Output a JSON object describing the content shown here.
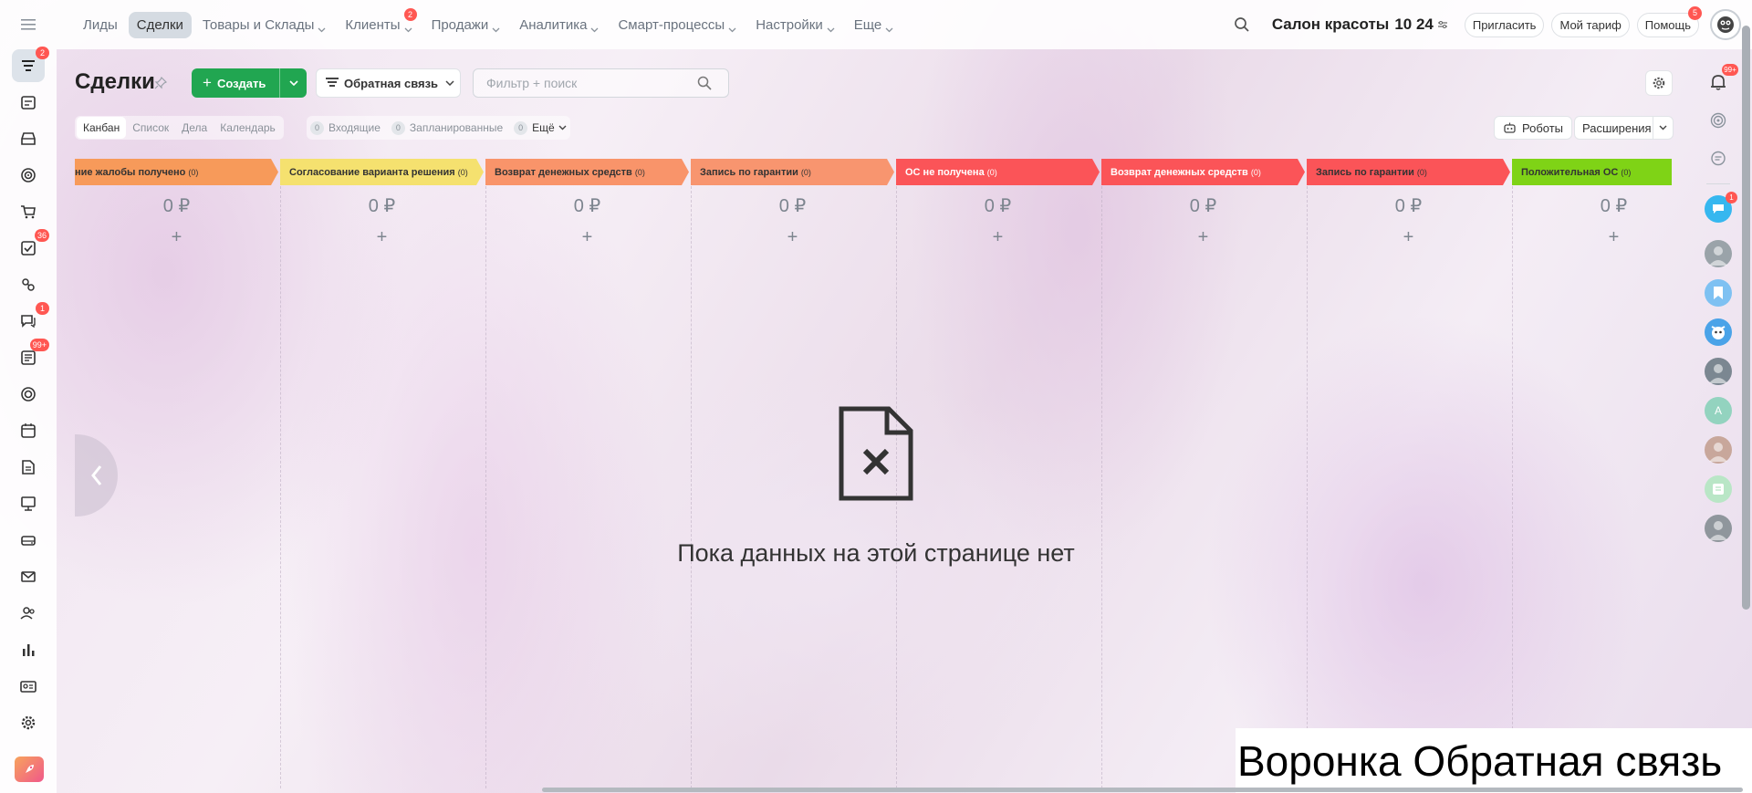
{
  "left_sidebar": {
    "items": [
      {
        "icon": "filter-funnel-icon",
        "badge": "2",
        "active": true
      },
      {
        "icon": "calendar-list-icon",
        "badge": ""
      },
      {
        "icon": "inbox-box-icon",
        "badge": ""
      },
      {
        "icon": "target-icon",
        "badge": ""
      },
      {
        "icon": "shopping-cart-icon",
        "badge": ""
      },
      {
        "icon": "task-check-icon",
        "badge": "36"
      },
      {
        "icon": "automation-icon",
        "badge": ""
      },
      {
        "icon": "chat-bubbles-icon",
        "badge": "1"
      },
      {
        "icon": "news-feed-icon",
        "badge": "99+"
      },
      {
        "icon": "lifebuoy-icon",
        "badge": ""
      },
      {
        "icon": "calendar-icon",
        "badge": ""
      },
      {
        "icon": "document-icon",
        "badge": ""
      },
      {
        "icon": "presentation-icon",
        "badge": ""
      },
      {
        "icon": "hard-drive-icon",
        "badge": ""
      },
      {
        "icon": "mail-icon",
        "badge": ""
      },
      {
        "icon": "contacts-icon",
        "badge": ""
      },
      {
        "icon": "bar-chart-icon",
        "badge": ""
      },
      {
        "icon": "id-card-icon",
        "badge": ""
      },
      {
        "icon": "settings-gear-icon",
        "badge": ""
      }
    ]
  },
  "topnav": {
    "items": [
      {
        "label": "Лиды",
        "chevron": false,
        "active": false,
        "badge": ""
      },
      {
        "label": "Сделки",
        "chevron": false,
        "active": true,
        "badge": ""
      },
      {
        "label": "Товары и Склады",
        "chevron": true,
        "active": false,
        "badge": ""
      },
      {
        "label": "Клиенты",
        "chevron": true,
        "active": false,
        "badge": "2"
      },
      {
        "label": "Продажи",
        "chevron": true,
        "active": false,
        "badge": ""
      },
      {
        "label": "Аналитика",
        "chevron": true,
        "active": false,
        "badge": ""
      },
      {
        "label": "Смарт-процессы",
        "chevron": true,
        "active": false,
        "badge": ""
      },
      {
        "label": "Настройки",
        "chevron": true,
        "active": false,
        "badge": ""
      },
      {
        "label": "Еще",
        "chevron": true,
        "active": false,
        "badge": ""
      }
    ],
    "company": "Салон красоты",
    "time": "10 24",
    "invite_label": "Пригласить",
    "tariff_label": "Мой тариф",
    "help_label": "Помощь",
    "help_badge": "5"
  },
  "page": {
    "title": "Сделки",
    "create_label": "Создать",
    "pipeline_label": "Обратная связь",
    "search_placeholder": "Фильтр + поиск",
    "views": [
      {
        "label": "Канбан",
        "active": true
      },
      {
        "label": "Список",
        "active": false
      },
      {
        "label": "Дела",
        "active": false
      },
      {
        "label": "Календарь",
        "active": false
      }
    ],
    "counters": [
      {
        "count": "0",
        "label": "Входящие"
      },
      {
        "count": "0",
        "label": "Запланированные"
      }
    ],
    "more_count": "0",
    "more_label": "Ещё",
    "robots_label": "Роботы",
    "extensions_label": "Расширения"
  },
  "kanban": {
    "columns": [
      {
        "title": "ние жалобы получено",
        "count": "(0)",
        "sum": "0 ₽",
        "add": "+",
        "color": "#f79a5a",
        "text_color": "#333333"
      },
      {
        "title": "Согласование варианта решения",
        "count": "(0)",
        "sum": "0 ₽",
        "add": "+",
        "color": "#f5e16f",
        "text_color": "#333333"
      },
      {
        "title": "Возврат денежных средств",
        "count": "(0)",
        "sum": "0 ₽",
        "add": "+",
        "color": "#f9946a",
        "text_color": "#333333"
      },
      {
        "title": "Запись по гарантии",
        "count": "(0)",
        "sum": "0 ₽",
        "add": "+",
        "color": "#f8956f",
        "text_color": "#333333"
      },
      {
        "title": "ОС не получена",
        "count": "(0)",
        "sum": "0 ₽",
        "add": "+",
        "color": "#fb5458",
        "text_color": "#ffffff"
      },
      {
        "title": "Возврат денежных средств",
        "count": "(0)",
        "sum": "0 ₽",
        "add": "+",
        "color": "#fb5458",
        "text_color": "#ffffff"
      },
      {
        "title": "Запись по гарантии",
        "count": "(0)",
        "sum": "0 ₽",
        "add": "+",
        "color": "#fb5458",
        "text_color": "#333333"
      },
      {
        "title": "Положительная ОС",
        "count": "(0)",
        "sum": "0 ₽",
        "add": "+",
        "color": "#7fd316",
        "text_color": "#333333"
      }
    ]
  },
  "empty_state": {
    "text": "Пока данных на этой странице нет"
  },
  "right_sidebar": {
    "notifications_badge": "99+",
    "chat_badge": "1",
    "avatars": [
      {
        "kind": "photo",
        "color": "#9aa3a9",
        "letter": ""
      },
      {
        "kind": "bookmark",
        "color": "#7ec1f2",
        "letter": ""
      },
      {
        "kind": "mascot",
        "color": "#4aa3e8",
        "letter": ""
      },
      {
        "kind": "photo",
        "color": "#7b8791",
        "letter": ""
      },
      {
        "kind": "letter",
        "color": "#93d3bf",
        "letter": "A"
      },
      {
        "kind": "photo",
        "color": "#c8a79b",
        "letter": ""
      },
      {
        "kind": "notes",
        "color": "#b9e6c6",
        "letter": ""
      },
      {
        "kind": "photo",
        "color": "#8f969c",
        "letter": ""
      }
    ]
  },
  "caption": "Воронка Обратная связь"
}
